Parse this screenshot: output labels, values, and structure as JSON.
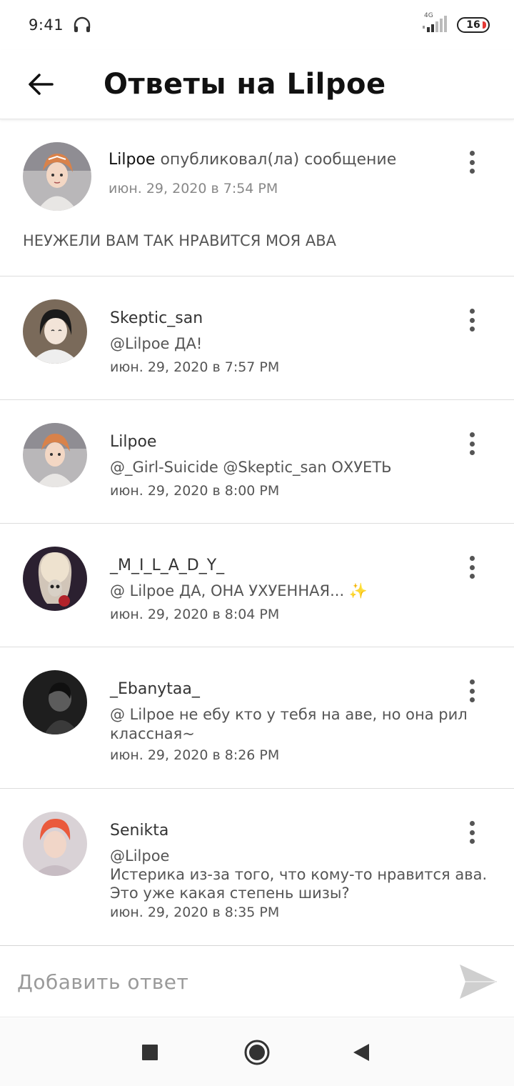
{
  "status_bar": {
    "time": "9:41",
    "network": "4G",
    "battery": "16"
  },
  "header": {
    "title": "Ответы на Lilpoe"
  },
  "post": {
    "author": "Lilpoe",
    "action": " опубликовал(ла) сообщение",
    "date": "июн. 29, 2020 в 7:54 PM",
    "text": "НЕУЖЕЛИ ВАМ ТАК НРАВИТСЯ МОЯ АВА"
  },
  "replies": [
    {
      "name": "Skeptic_san",
      "text": "@Lilpoe  ДА!",
      "date": "июн. 29, 2020 в 7:57 PM"
    },
    {
      "name": "Lilpoe",
      "text": "@_Girl-Suicide  @Skeptic_san  ОХУЕТЬ",
      "date": "июн. 29, 2020 в 8:00 PM"
    },
    {
      "name": "_M_I_L_A_D_Y_",
      "text": "@ Lilpoe  ДА, ОНА УХУЕННАЯ... ✨",
      "date": "июн. 29, 2020 в 8:04 PM"
    },
    {
      "name": "_Ebanytaa_",
      "text": "@ Lilpoe  не ебу кто у тебя на аве, но она рил классная~",
      "date": "июн. 29, 2020 в 8:26 PM"
    },
    {
      "name": "Senikta",
      "text": "@Lilpoe\nИстерика из-за того, что кому-то нравится ава. Это уже какая степень шизы?",
      "date": "июн. 29, 2020 в 8:35 PM"
    }
  ],
  "composer": {
    "placeholder": "Добавить ответ"
  },
  "icons": {
    "back": "arrow-left-icon",
    "more": "more-vertical-icon",
    "send": "send-icon",
    "nav_recents": "square-icon",
    "nav_home": "circle-icon",
    "nav_back": "triangle-back-icon"
  },
  "colors": {
    "text_primary": "#111111",
    "text_secondary": "#555555",
    "divider": "#dddddd",
    "send_icon": "#c8c8c8"
  }
}
